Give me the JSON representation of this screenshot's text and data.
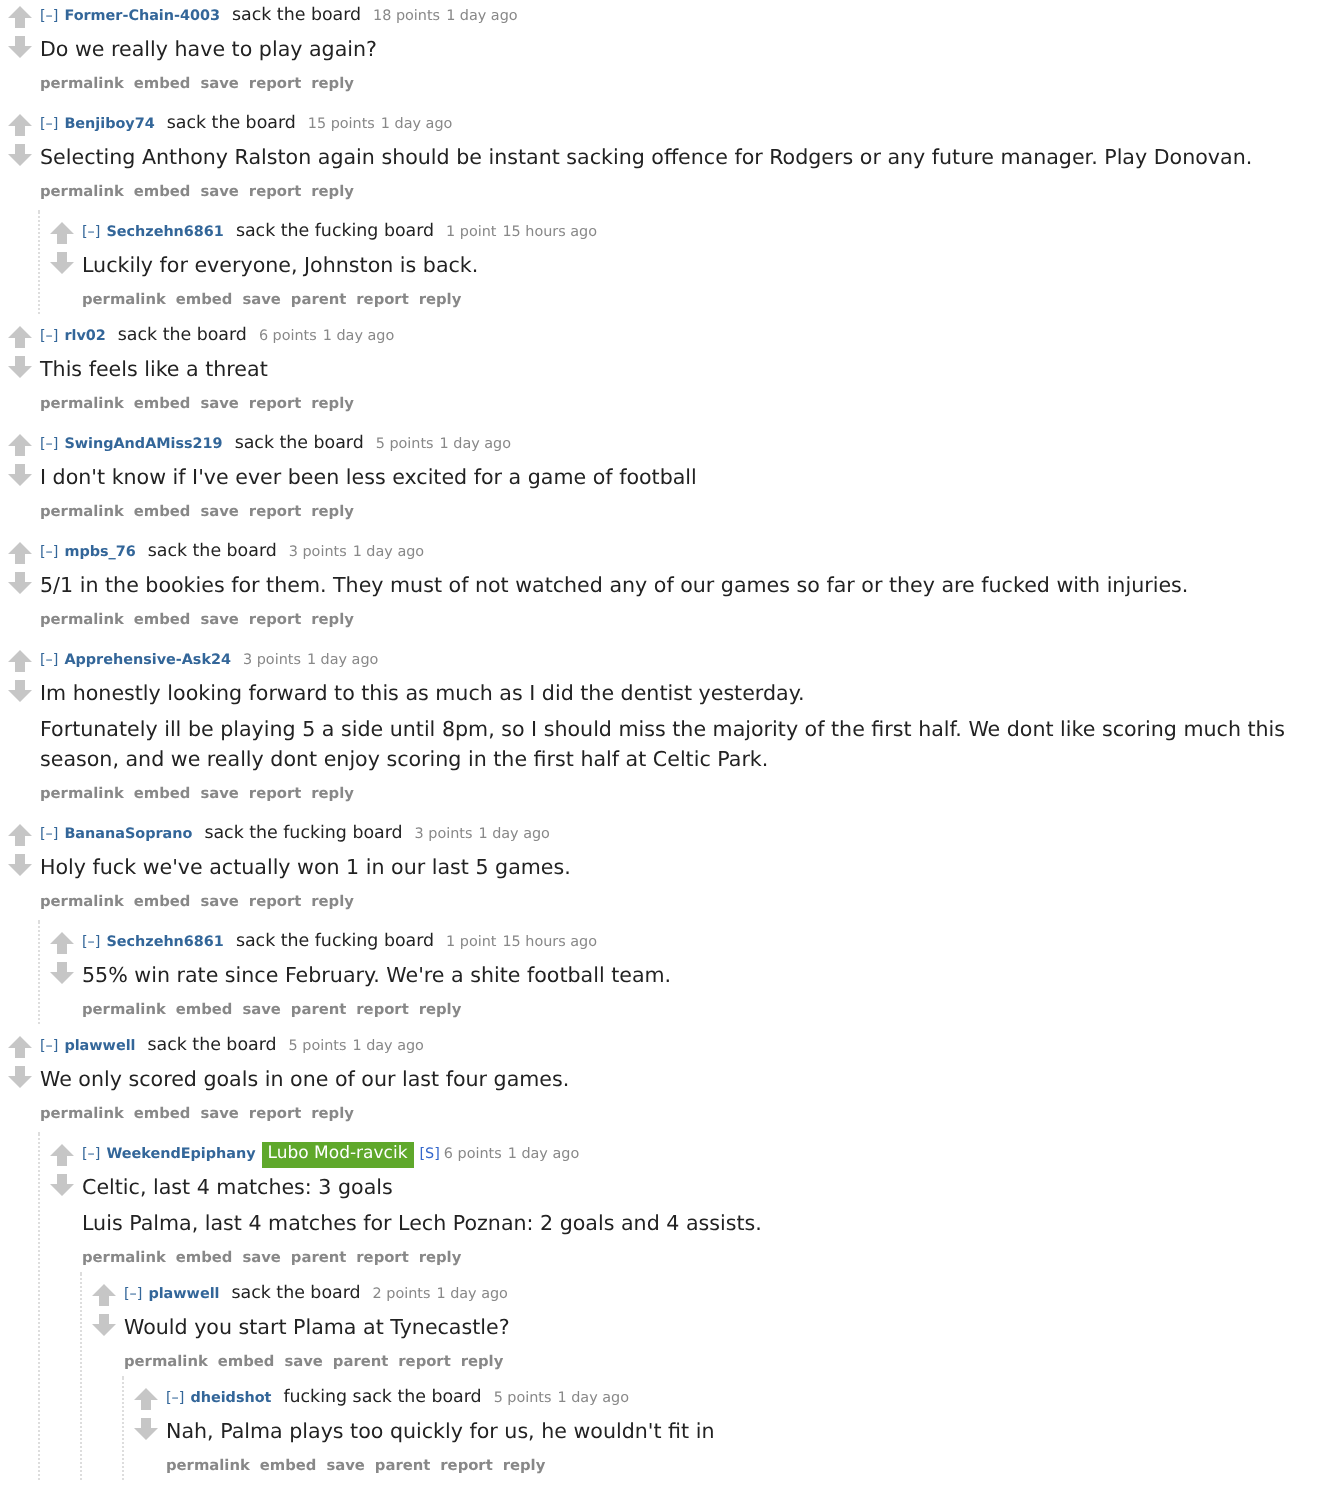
{
  "comments": [
    {
      "toggle": "[–]",
      "author": "Former-Chain-4003",
      "flair": "sack the board",
      "score": "18 points",
      "time": "1 day ago",
      "body": [
        "Do we really have to play again?"
      ],
      "actions": [
        "permalink",
        "embed",
        "save",
        "report",
        "reply"
      ]
    },
    {
      "toggle": "[–]",
      "author": "Benjiboy74",
      "flair": "sack the board",
      "score": "15 points",
      "time": "1 day ago",
      "body": [
        "Selecting Anthony Ralston again should be instant sacking offence for Rodgers or any future manager. Play Donovan."
      ],
      "actions": [
        "permalink",
        "embed",
        "save",
        "report",
        "reply"
      ],
      "children": [
        {
          "toggle": "[–]",
          "author": "Sechzehn6861",
          "flair": "sack the fucking board",
          "score": "1 point",
          "time": "15 hours ago",
          "body": [
            "Luckily for everyone, Johnston is back."
          ],
          "actions": [
            "permalink",
            "embed",
            "save",
            "parent",
            "report",
            "reply"
          ]
        }
      ]
    },
    {
      "toggle": "[–]",
      "author": "rlv02",
      "flair": "sack the board",
      "score": "6 points",
      "time": "1 day ago",
      "body": [
        "This feels like a threat"
      ],
      "actions": [
        "permalink",
        "embed",
        "save",
        "report",
        "reply"
      ]
    },
    {
      "toggle": "[–]",
      "author": "SwingAndAMiss219",
      "flair": "sack the board",
      "score": "5 points",
      "time": "1 day ago",
      "body": [
        "I don't know if I've ever been less excited for a game of football"
      ],
      "actions": [
        "permalink",
        "embed",
        "save",
        "report",
        "reply"
      ]
    },
    {
      "toggle": "[–]",
      "author": "mpbs_76",
      "flair": "sack the board",
      "score": "3 points",
      "time": "1 day ago",
      "body": [
        "5/1 in the bookies for them. They must of not watched any of our games so far or they are fucked with injuries."
      ],
      "actions": [
        "permalink",
        "embed",
        "save",
        "report",
        "reply"
      ]
    },
    {
      "toggle": "[–]",
      "author": "Apprehensive-Ask24",
      "score": "3 points",
      "time": "1 day ago",
      "body": [
        "Im honestly looking forward to this as much as I did the dentist yesterday.",
        "Fortunately ill be playing 5 a side until 8pm, so I should miss the majority of the first half. We dont like scoring much this season, and we really dont enjoy scoring in the first half at Celtic Park."
      ],
      "actions": [
        "permalink",
        "embed",
        "save",
        "report",
        "reply"
      ]
    },
    {
      "toggle": "[–]",
      "author": "BananaSoprano",
      "flair": "sack the fucking board",
      "score": "3 points",
      "time": "1 day ago",
      "body": [
        "Holy fuck we've actually won 1 in our last 5 games."
      ],
      "actions": [
        "permalink",
        "embed",
        "save",
        "report",
        "reply"
      ],
      "children": [
        {
          "toggle": "[–]",
          "author": "Sechzehn6861",
          "flair": "sack the fucking board",
          "score": "1 point",
          "time": "15 hours ago",
          "body": [
            "55% win rate since February. We're a shite football team."
          ],
          "actions": [
            "permalink",
            "embed",
            "save",
            "parent",
            "report",
            "reply"
          ]
        }
      ]
    },
    {
      "toggle": "[–]",
      "author": "plawwell",
      "flair": "sack the board",
      "score": "5 points",
      "time": "1 day ago",
      "body": [
        "We only scored goals in one of our last four games."
      ],
      "actions": [
        "permalink",
        "embed",
        "save",
        "report",
        "reply"
      ],
      "children": [
        {
          "toggle": "[–]",
          "author": "WeekendEpiphany",
          "flair_badge": "Lubo Mod-ravcik",
          "submitter": "[S]",
          "score": "6 points",
          "time": "1 day ago",
          "body": [
            "Celtic, last 4 matches: 3 goals",
            "Luis Palma, last 4 matches for Lech Poznan: 2 goals and 4 assists."
          ],
          "actions": [
            "permalink",
            "embed",
            "save",
            "parent",
            "report",
            "reply"
          ],
          "children": [
            {
              "toggle": "[–]",
              "author": "plawwell",
              "flair": "sack the board",
              "score": "2 points",
              "time": "1 day ago",
              "body": [
                "Would you start Plama at Tynecastle?"
              ],
              "actions": [
                "permalink",
                "embed",
                "save",
                "parent",
                "report",
                "reply"
              ],
              "children": [
                {
                  "toggle": "[–]",
                  "author": "dheidshot",
                  "flair": "fucking sack the board",
                  "score": "5 points",
                  "time": "1 day ago",
                  "body": [
                    "Nah, Palma plays too quickly for us, he wouldn't fit in"
                  ],
                  "actions": [
                    "permalink",
                    "embed",
                    "save",
                    "parent",
                    "report",
                    "reply"
                  ]
                }
              ]
            }
          ]
        }
      ]
    }
  ]
}
